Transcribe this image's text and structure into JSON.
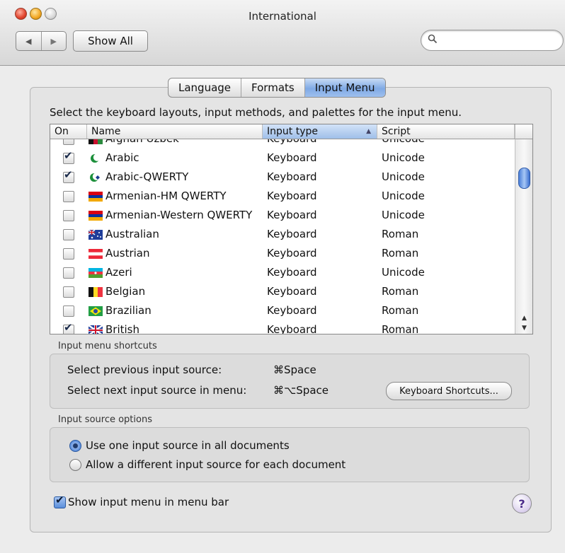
{
  "window": {
    "title": "International"
  },
  "toolbar": {
    "back_glyph": "◀",
    "forward_glyph": "▶",
    "show_all": "Show All",
    "search_placeholder": "",
    "search_icon": "magnifier"
  },
  "tabs": [
    {
      "label": "Language",
      "active": false
    },
    {
      "label": "Formats",
      "active": false
    },
    {
      "label": "Input Menu",
      "active": true
    }
  ],
  "instructions": "Select the keyboard layouts, input methods, and palettes for the input menu.",
  "table": {
    "columns": {
      "on": "On",
      "name": "Name",
      "input_type": "Input type",
      "script": "Script"
    },
    "rows": [
      {
        "on": false,
        "name": "Afghan Uzbek",
        "type": "Keyboard",
        "script": "Unicode",
        "flag": "afghan-uzbek-flag"
      },
      {
        "on": true,
        "name": "Arabic",
        "type": "Keyboard",
        "script": "Unicode",
        "flag": "arabic-crescent-icon"
      },
      {
        "on": true,
        "name": "Arabic-QWERTY",
        "type": "Keyboard",
        "script": "Unicode",
        "flag": "arabic-qwerty-icon"
      },
      {
        "on": false,
        "name": "Armenian-HM QWERTY",
        "type": "Keyboard",
        "script": "Unicode",
        "flag": "armenia-flag"
      },
      {
        "on": false,
        "name": "Armenian-Western QWERTY",
        "type": "Keyboard",
        "script": "Unicode",
        "flag": "armenia-flag"
      },
      {
        "on": false,
        "name": "Australian",
        "type": "Keyboard",
        "script": "Roman",
        "flag": "australia-flag"
      },
      {
        "on": false,
        "name": "Austrian",
        "type": "Keyboard",
        "script": "Roman",
        "flag": "austria-flag"
      },
      {
        "on": false,
        "name": "Azeri",
        "type": "Keyboard",
        "script": "Unicode",
        "flag": "azerbaijan-flag"
      },
      {
        "on": false,
        "name": "Belgian",
        "type": "Keyboard",
        "script": "Roman",
        "flag": "belgium-flag"
      },
      {
        "on": false,
        "name": "Brazilian",
        "type": "Keyboard",
        "script": "Roman",
        "flag": "brazil-flag"
      },
      {
        "on": true,
        "name": "British",
        "type": "Keyboard",
        "script": "Roman",
        "flag": "uk-flag"
      }
    ]
  },
  "shortcuts": {
    "label": "Input menu shortcuts",
    "prev_label": "Select previous input source:",
    "prev_key": "⌘Space",
    "next_label": "Select next input source in menu:",
    "next_key": "⌘⌥Space",
    "button": "Keyboard Shortcuts..."
  },
  "options": {
    "label": "Input source options",
    "one": "Use one input source in all documents",
    "different": "Allow a different input source for each document",
    "selected": "one"
  },
  "show_menu": {
    "label": "Show input menu in menu bar",
    "checked": true
  },
  "help_glyph": "?",
  "colors": {
    "selection": "#7fa9e5",
    "thumb": "#4a7fd8"
  }
}
